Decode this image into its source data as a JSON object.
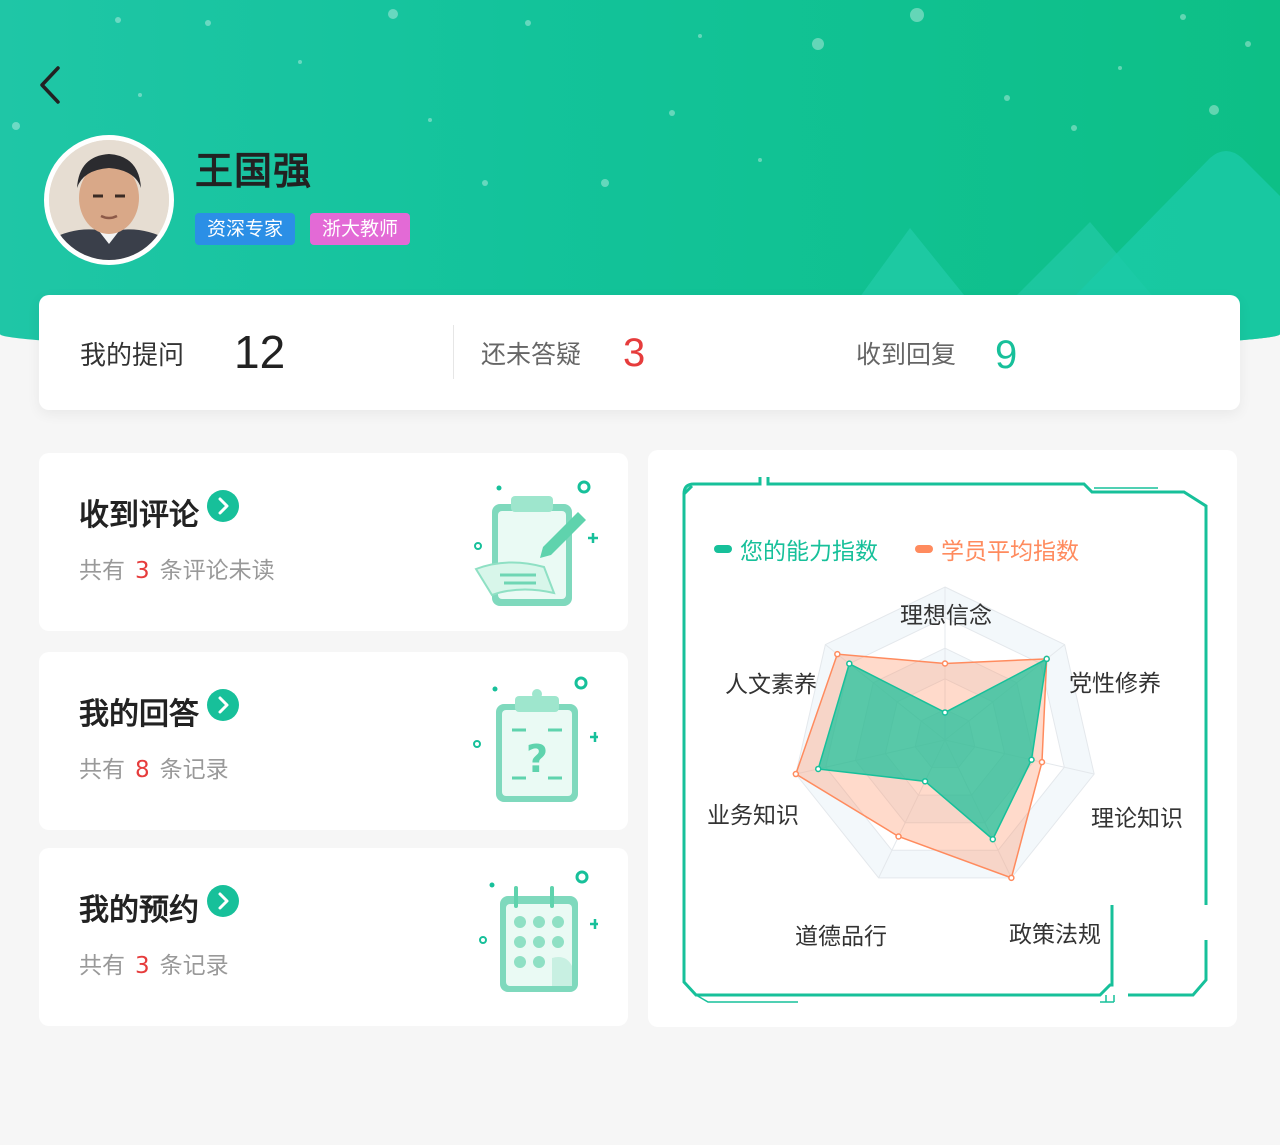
{
  "header": {
    "back_icon": "chevron-left-icon"
  },
  "profile": {
    "name": "王国强",
    "tags": [
      "资深专家",
      "浙大教师"
    ],
    "tag_colors": [
      "#2b8fe6",
      "#e36ad6"
    ]
  },
  "stats": [
    {
      "label": "我的提问",
      "value": "12",
      "color": "#222222"
    },
    {
      "label": "还未答疑",
      "value": "3",
      "color": "#e63c3c"
    },
    {
      "label": "收到回复",
      "value": "9",
      "color": "#17c09a"
    }
  ],
  "cards": [
    {
      "title": "收到评论",
      "sub_prefix": "共有",
      "count": "3",
      "sub_suffix": "条评论未读",
      "icon": "clipboard-edit-icon"
    },
    {
      "title": "我的回答",
      "sub_prefix": "共有",
      "count": "8",
      "sub_suffix": "条记录",
      "icon": "clipboard-question-icon"
    },
    {
      "title": "我的预约",
      "sub_prefix": "共有",
      "count": "3",
      "sub_suffix": "条记录",
      "icon": "calendar-icon"
    }
  ],
  "colors": {
    "accent": "#17c09a",
    "secondary": "#ff8b5e",
    "alert": "#e63c3c"
  },
  "chart_data": {
    "type": "radar",
    "axes": [
      "理想信念",
      "党性修养",
      "理论知识",
      "政策法规",
      "道德品行",
      "业务知识",
      "人文素养"
    ],
    "series": [
      {
        "name": "您的能力指数",
        "color": "#17c09a",
        "values": [
          0.18,
          0.85,
          0.58,
          0.72,
          0.3,
          0.85,
          0.8
        ]
      },
      {
        "name": "学员平均指数",
        "color": "#ff8b5e",
        "values": [
          0.5,
          0.85,
          0.65,
          1.0,
          0.7,
          1.0,
          0.9
        ]
      }
    ],
    "range": [
      0,
      1
    ],
    "rings": 5
  }
}
